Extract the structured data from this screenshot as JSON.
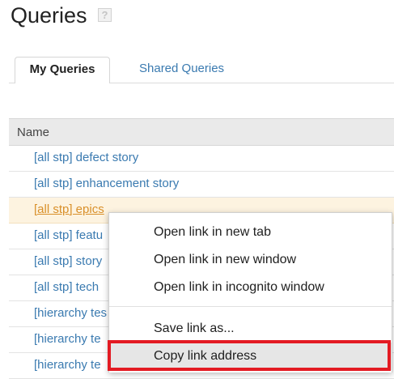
{
  "page": {
    "title": "Queries",
    "help_icon": "question-mark-icon",
    "help_glyph": "?"
  },
  "tabs": [
    {
      "label": "My Queries",
      "active": true
    },
    {
      "label": "Shared Queries",
      "active": false
    }
  ],
  "table": {
    "column_header": "Name",
    "rows": [
      {
        "label": "[all stp] defect story",
        "highlighted": false
      },
      {
        "label": "[all stp] enhancement story",
        "highlighted": false
      },
      {
        "label": "[all stp] epics",
        "highlighted": true
      },
      {
        "label": "[all stp] featu",
        "highlighted": false
      },
      {
        "label": "[all stp] story",
        "highlighted": false
      },
      {
        "label": "[all stp] tech",
        "highlighted": false
      },
      {
        "label": "[hierarchy tes",
        "highlighted": false
      },
      {
        "label": "[hierarchy te",
        "highlighted": false
      },
      {
        "label": "[hierarchy te",
        "highlighted": false
      }
    ]
  },
  "context_menu": {
    "items": [
      {
        "label": "Open link in new tab",
        "hovered": false
      },
      {
        "label": "Open link in new window",
        "hovered": false
      },
      {
        "label": "Open link in incognito window",
        "hovered": false
      },
      {
        "label": "Save link as...",
        "hovered": false
      },
      {
        "label": "Copy link address",
        "hovered": true
      }
    ]
  },
  "colors": {
    "link": "#3a7ab0",
    "highlight_row_bg": "#fdf3e0",
    "highlight_link": "#d9902a",
    "annotation_box": "#e31b23"
  }
}
